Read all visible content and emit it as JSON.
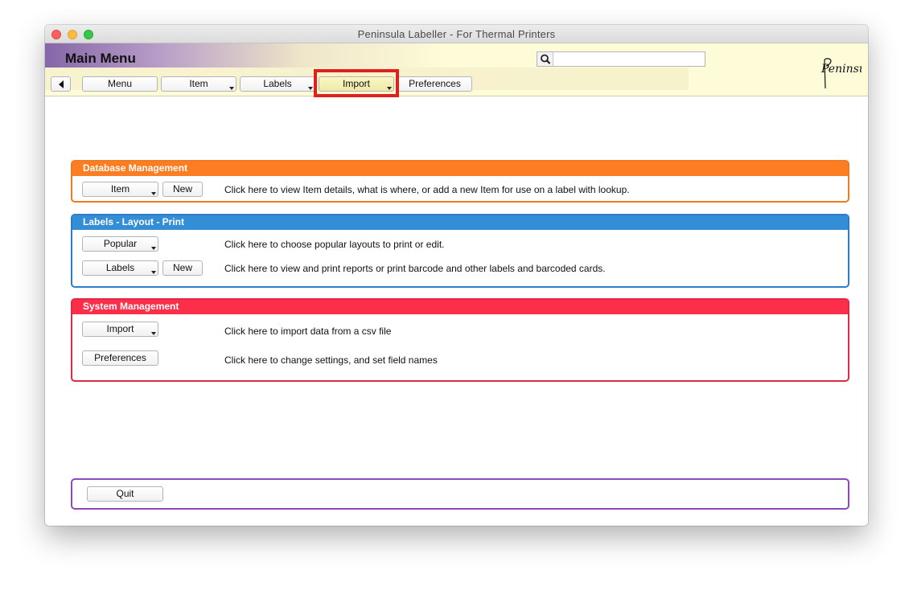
{
  "window": {
    "title": "Peninsula Labeller - For Thermal Printers"
  },
  "header": {
    "title": "Main Menu",
    "search": {
      "value": "",
      "placeholder": ""
    },
    "logo_text": "Peninsula"
  },
  "toolbar": {
    "back_icon": "triangle-left-icon",
    "items": [
      {
        "label": "Menu"
      },
      {
        "label": "Item"
      },
      {
        "label": "Labels"
      },
      {
        "label": "Import"
      },
      {
        "label": "Preferences"
      }
    ]
  },
  "sections": {
    "database": {
      "title": "Database Management",
      "row1": {
        "button": "Item",
        "button2": "New",
        "text": "Click here to view Item details, what is where, or add a new Item for use on a label with lookup."
      }
    },
    "labels": {
      "title": "Labels - Layout - Print",
      "row1": {
        "button": "Popular",
        "text": "Click here to choose popular layouts to print or edit."
      },
      "row2": {
        "button": "Labels",
        "button2": "New",
        "text": "Click here to view and print reports or print barcode and other labels and barcoded cards."
      }
    },
    "system": {
      "title": "System Management",
      "row1": {
        "button": "Import",
        "text": "Click here to import data from a csv file"
      },
      "row2": {
        "button": "Preferences",
        "text": "Click here to change settings, and set field names"
      }
    },
    "quit": {
      "button": "Quit"
    }
  },
  "colors": {
    "database": "#fd7e22",
    "labels": "#338ed6",
    "system": "#fd2e4a",
    "quit": "#8e49b8",
    "highlight": "#e0201b"
  }
}
